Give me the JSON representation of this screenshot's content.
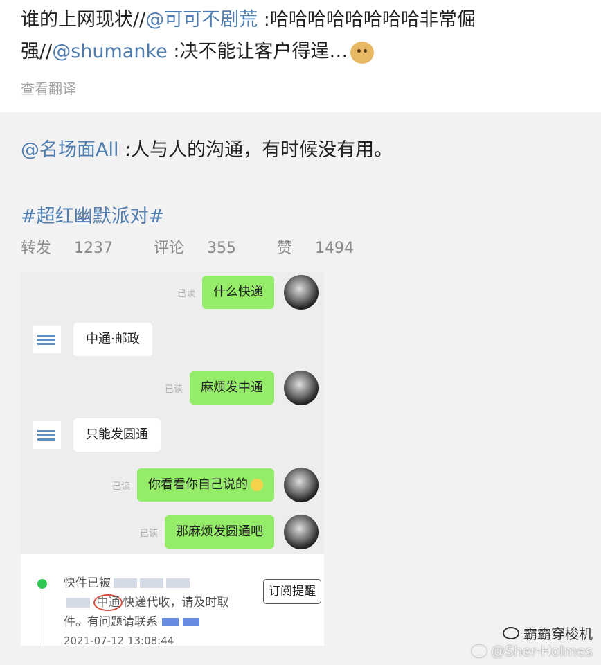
{
  "post": {
    "line1_prefix": "谁的上网现状//",
    "mention1": "@可可不剧荒",
    "line1_suffix": " :哈哈哈哈哈哈哈哈非常倔",
    "line2_prefix": "强//",
    "mention2": "@shumanke",
    "line2_suffix": " :决不能让客户得逞…",
    "emoji": "doge-emoji",
    "translate_label": "查看翻译"
  },
  "repost": {
    "mention": "@名场面All",
    "text": " :人与人的沟通，有时候没有用。",
    "hashtag": "#超红幽默派对#",
    "stats": {
      "repost_label": "转发",
      "repost_count": "1237",
      "comment_label": "评论",
      "comment_count": "355",
      "like_label": "赞",
      "like_count": "1494"
    }
  },
  "chat": {
    "read_label": "已读",
    "messages": [
      {
        "side": "right",
        "text": "什么快递"
      },
      {
        "side": "left",
        "text": "中通·邮政"
      },
      {
        "side": "right",
        "text": "麻烦发中通"
      },
      {
        "side": "left",
        "text": "只能发圆通"
      },
      {
        "side": "right",
        "text": "你看看你自己说的"
      },
      {
        "side": "right",
        "text": "那麻烦发圆通吧"
      }
    ],
    "express": {
      "line1": "快件已被",
      "line2_circled": "中通",
      "line2_rest": "快递代收，请及时取",
      "line3": "件。有问题请联系",
      "date": "2021-07-12 13:08:44",
      "subscribe_label": "订阅提醒"
    }
  },
  "watermark": {
    "name": "霸霸穿梭机",
    "handle": "@Sher-Holmes"
  }
}
